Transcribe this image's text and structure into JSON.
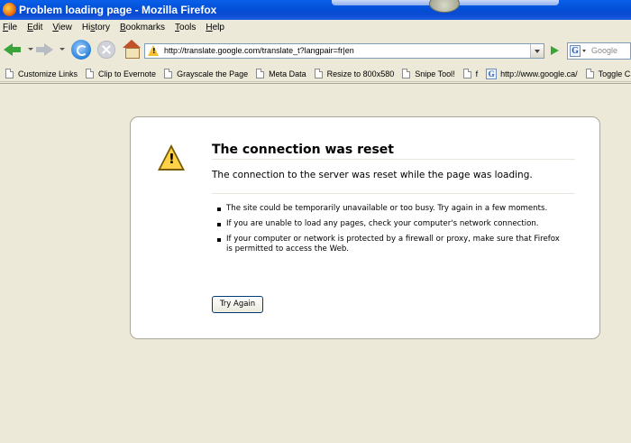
{
  "window": {
    "title": "Problem loading page - Mozilla Firefox"
  },
  "menubar": {
    "items": [
      "File",
      "Edit",
      "View",
      "History",
      "Bookmarks",
      "Tools",
      "Help"
    ],
    "accesskeys": [
      "F",
      "E",
      "V",
      "s",
      "B",
      "T",
      "H"
    ]
  },
  "navbar": {
    "url": "http://translate.google.com/translate_t?langpair=fr|en",
    "search_placeholder": "Google",
    "search_engine_letter": "G"
  },
  "bookmarks": {
    "items": [
      {
        "label": "Customize Links",
        "icon": "page-icon"
      },
      {
        "label": "Clip to Evernote",
        "icon": "page-icon"
      },
      {
        "label": "Grayscale the Page",
        "icon": "page-icon"
      },
      {
        "label": "Meta Data",
        "icon": "page-icon"
      },
      {
        "label": "Resize to 800x580",
        "icon": "page-icon"
      },
      {
        "label": "Snipe Tool!",
        "icon": "page-icon"
      },
      {
        "label": "f",
        "icon": "page-icon"
      },
      {
        "label": "http://www.google.ca/",
        "icon": "google-icon",
        "letter": "G"
      },
      {
        "label": "Toggle CSS",
        "icon": "page-icon"
      }
    ]
  },
  "error": {
    "title": "The connection was reset",
    "description": "The connection to the server was reset while the page was loading.",
    "bullets": [
      "The site could be temporarily unavailable or too busy. Try again in a few moments.",
      "If you are unable to load any pages, check your computer's network connection.",
      "If your computer or network is protected by a firewall or proxy, make sure that Firefox is permitted to access the Web."
    ],
    "button_label": "Try Again"
  }
}
